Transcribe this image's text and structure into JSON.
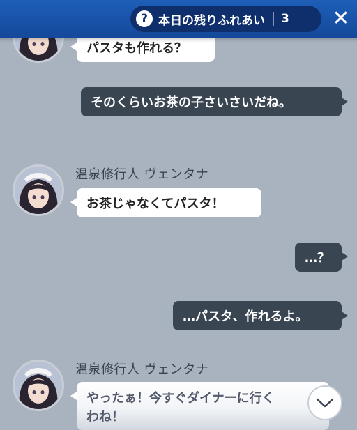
{
  "header": {
    "help_icon": "?",
    "counter_label": "本日の残りふれあい",
    "counter_value": "3",
    "close_icon": "✕"
  },
  "messages": [
    {
      "sender": "",
      "text": "パスタも作れる？",
      "direction": "incoming"
    },
    {
      "text": "そのくらいお茶の子さいさいだね。",
      "direction": "outgoing"
    },
    {
      "sender": "温泉修行人 ヴェンタナ",
      "text": "お茶じゃなくてパスタ！",
      "direction": "incoming"
    },
    {
      "text": "…？",
      "direction": "outgoing"
    },
    {
      "text": "…パスタ、作れるよ。",
      "direction": "outgoing"
    },
    {
      "sender": "温泉修行人 ヴェンタナ",
      "text_line1": "やったぁ！今すぐダイナーに行く",
      "text_line2": "わね！",
      "direction": "incoming"
    }
  ],
  "colors": {
    "header": "#1a56ac",
    "background": "#a9b2bf",
    "outgoing_bubble": "#3a4552",
    "incoming_bubble": "#ffffff"
  }
}
